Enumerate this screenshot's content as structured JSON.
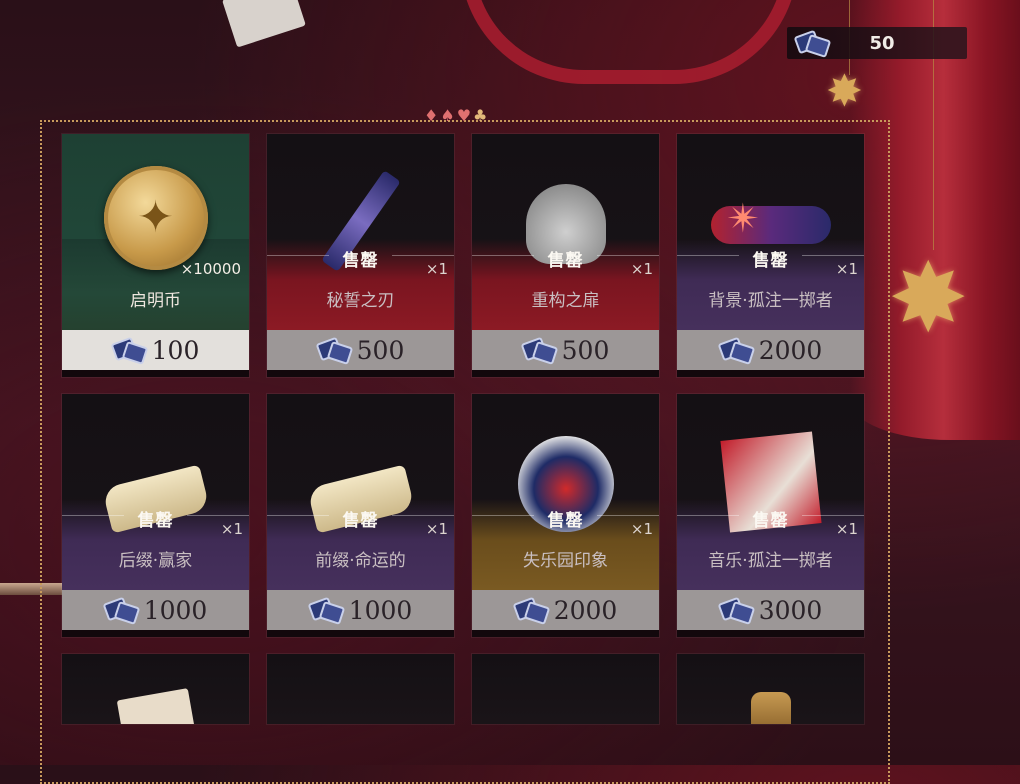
{
  "currency": {
    "amount": "50",
    "icon": "ticket-icon"
  },
  "suits": [
    "♦",
    "♠",
    "♥",
    "♣"
  ],
  "sold_label": "售罄",
  "rows": [
    [
      {
        "name": "启明币",
        "qty": "×10000",
        "price": "100",
        "icon": "gold-coin-icon",
        "style": "green",
        "sold_out": false
      },
      {
        "name": "秘誓之刃",
        "qty": "×1",
        "price": "500",
        "icon": "dagger-icon",
        "style": "red",
        "sold_out": true
      },
      {
        "name": "重构之扉",
        "qty": "×1",
        "price": "500",
        "icon": "silver-fan-icon",
        "style": "red",
        "sold_out": true
      },
      {
        "name": "背景·孤注一掷者",
        "qty": "×1",
        "price": "2000",
        "icon": "banner-icon",
        "style": "purple",
        "sold_out": true
      }
    ],
    [
      {
        "name": "后缀·赢家",
        "qty": "×1",
        "price": "1000",
        "icon": "scroll-icon",
        "style": "purple",
        "sold_out": true
      },
      {
        "name": "前缀·命运的",
        "qty": "×1",
        "price": "1000",
        "icon": "scroll-icon",
        "style": "purple",
        "sold_out": true
      },
      {
        "name": "失乐园印象",
        "qty": "×1",
        "price": "2000",
        "icon": "card-scene-icon",
        "style": "gold",
        "sold_out": true
      },
      {
        "name": "音乐·孤注一掷者",
        "qty": "×1",
        "price": "3000",
        "icon": "music-album-icon",
        "style": "purple",
        "sold_out": true
      }
    ]
  ],
  "row3_icons": [
    "letter-icon",
    "empty",
    "empty",
    "teapot-icon"
  ]
}
